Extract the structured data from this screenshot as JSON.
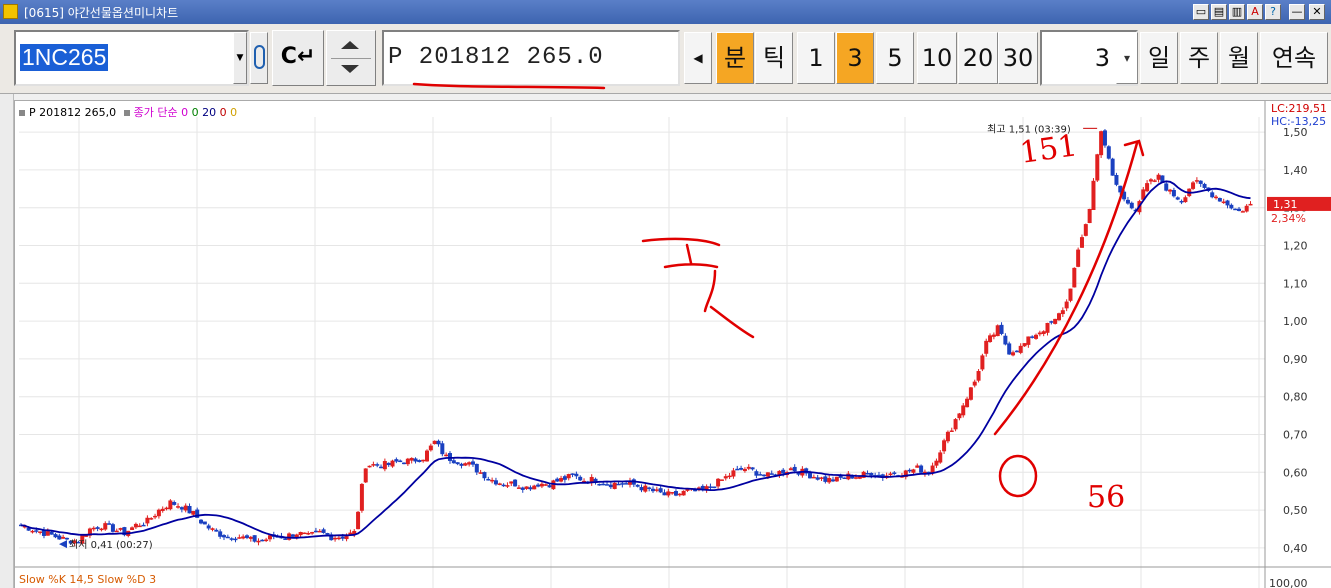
{
  "window": {
    "title": "[0615] 야간선물옵션미니차트",
    "controls": [
      "▭",
      "▤",
      "▥",
      "A",
      "?",
      "—",
      "✕"
    ]
  },
  "toolbar": {
    "symbol_code": "1NC265",
    "enter_label": "C↵",
    "contract": "P 201812 265.0",
    "period_buttons": [
      {
        "label": "분",
        "active": true
      },
      {
        "label": "틱",
        "active": false
      },
      {
        "label": "1",
        "active": false
      },
      {
        "label": "3",
        "active": true
      },
      {
        "label": "5",
        "active": false
      },
      {
        "label": "10",
        "active": false
      },
      {
        "label": "20",
        "active": false
      },
      {
        "label": "30",
        "active": false
      }
    ],
    "count": "3",
    "range_buttons": [
      "일",
      "주",
      "월",
      "연속"
    ]
  },
  "chart": {
    "legend_contract": "P 201812 265,0",
    "legend_ma": "종가 단순",
    "legend_ma_params": [
      "0",
      "0",
      "20",
      "0",
      "0"
    ],
    "legend_ma_colors": [
      "#d000d0",
      "#008000",
      "#000080",
      "#c00000",
      "#d0a000"
    ],
    "lc_label": "LC:219,51",
    "hc_label": "HC:-13,25",
    "current_price": "1,31",
    "change_pct": "2,34%",
    "high_annotation": "최고 1,51 (03:39)",
    "low_annotation": "최저 0,41 (00:27)",
    "y_ticks": [
      "1,50",
      "1,40",
      "1,30",
      "1,20",
      "1,10",
      "1,00",
      "0,90",
      "0,80",
      "0,70",
      "0,60",
      "0,50",
      "0,40"
    ],
    "oscillator_legend": "Slow %K 14,5  Slow %D 3",
    "oscillator_top_tick": "100,00",
    "handwritten_notes": [
      "151",
      "56"
    ],
    "colors": {
      "up": "#e02020",
      "down": "#1a40c0",
      "ma": "#0000a0",
      "ink": "#e00000",
      "grid": "#e6e6e6"
    }
  },
  "chart_data": {
    "type": "candlestick",
    "ylim": [
      0.36,
      1.54
    ],
    "moving_average_period": 20,
    "high": 1.51,
    "low": 0.41,
    "last": 1.31,
    "price_path": [
      0.46,
      0.45,
      0.44,
      0.43,
      0.42,
      0.42,
      0.45,
      0.46,
      0.45,
      0.44,
      0.46,
      0.47,
      0.5,
      0.52,
      0.51,
      0.49,
      0.46,
      0.44,
      0.43,
      0.43,
      0.42,
      0.42,
      0.43,
      0.43,
      0.44,
      0.43,
      0.44,
      0.43,
      0.43,
      0.44,
      0.62,
      0.62,
      0.62,
      0.63,
      0.63,
      0.64,
      0.68,
      0.64,
      0.63,
      0.62,
      0.6,
      0.58,
      0.57,
      0.57,
      0.56,
      0.57,
      0.57,
      0.58,
      0.59,
      0.58,
      0.58,
      0.57,
      0.57,
      0.57,
      0.56,
      0.55,
      0.54,
      0.54,
      0.55,
      0.55,
      0.56,
      0.58,
      0.6,
      0.61,
      0.6,
      0.59,
      0.6,
      0.61,
      0.6,
      0.59,
      0.58,
      0.58,
      0.59,
      0.59,
      0.6,
      0.59,
      0.6,
      0.6,
      0.61,
      0.6,
      0.66,
      0.72,
      0.78,
      0.84,
      0.94,
      0.98,
      0.92,
      0.93,
      0.96,
      0.98,
      1.0,
      1.05,
      1.18,
      1.3,
      1.51,
      1.38,
      1.32,
      1.3,
      1.36,
      1.38,
      1.34,
      1.32,
      1.37,
      1.35,
      1.33,
      1.31,
      1.29,
      1.31
    ]
  }
}
